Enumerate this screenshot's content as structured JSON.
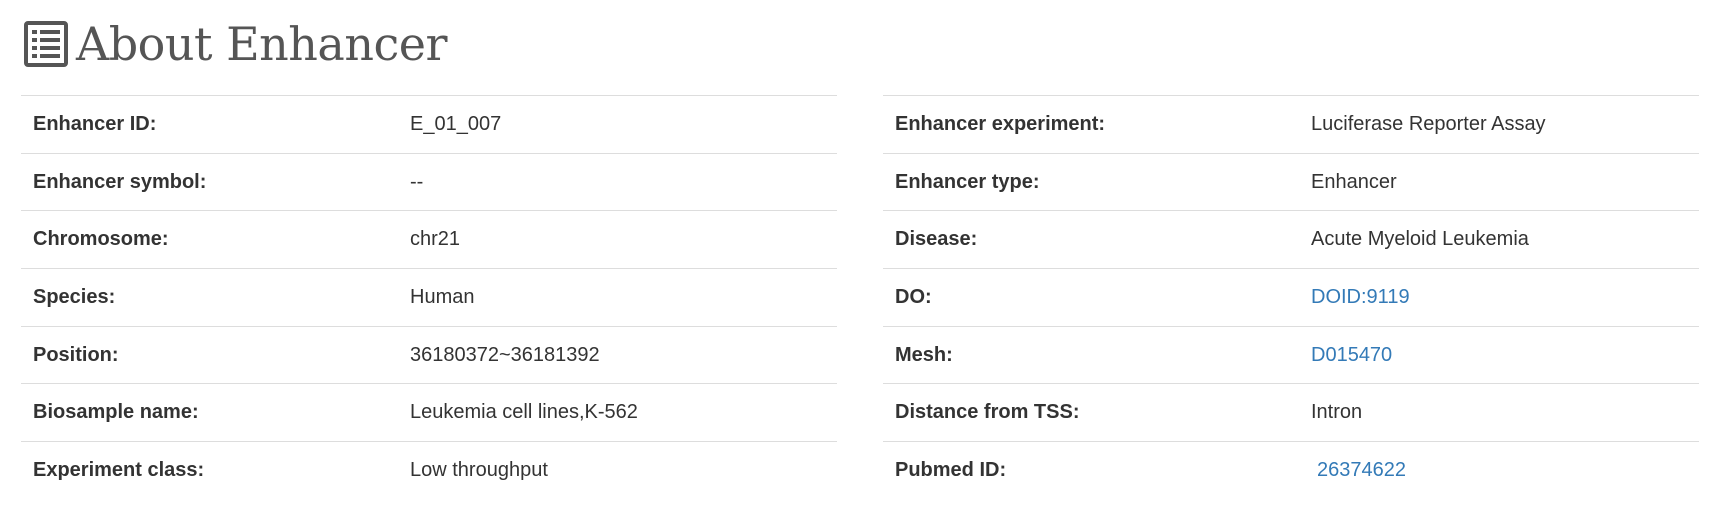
{
  "header": {
    "title": "About Enhancer",
    "icon": "list-icon"
  },
  "left_table": [
    {
      "label": "Enhancer ID:",
      "value": "E_01_007"
    },
    {
      "label": "Enhancer symbol:",
      "value": "--"
    },
    {
      "label": "Chromosome:",
      "value": "chr21"
    },
    {
      "label": "Species:",
      "value": "Human"
    },
    {
      "label": "Position:",
      "value": "36180372~36181392"
    },
    {
      "label": "Biosample name:",
      "value": "Leukemia cell lines,K-562"
    },
    {
      "label": "Experiment class:",
      "value": "Low throughput"
    }
  ],
  "right_table": [
    {
      "label": "Enhancer experiment:",
      "value": "Luciferase Reporter Assay"
    },
    {
      "label": "Enhancer type:",
      "value": "Enhancer"
    },
    {
      "label": "Disease:",
      "value": "Acute Myeloid Leukemia"
    },
    {
      "label": "DO:",
      "value": "DOID:9119"
    },
    {
      "label": "Mesh:",
      "value": "D015470"
    },
    {
      "label": "Distance from TSS:",
      "value": "Intron"
    },
    {
      "label": "Pubmed ID:",
      "value": "26374622"
    }
  ],
  "colors": {
    "link": "#337ab7",
    "text": "#333333",
    "title": "#555555",
    "border": "#dddddd"
  }
}
